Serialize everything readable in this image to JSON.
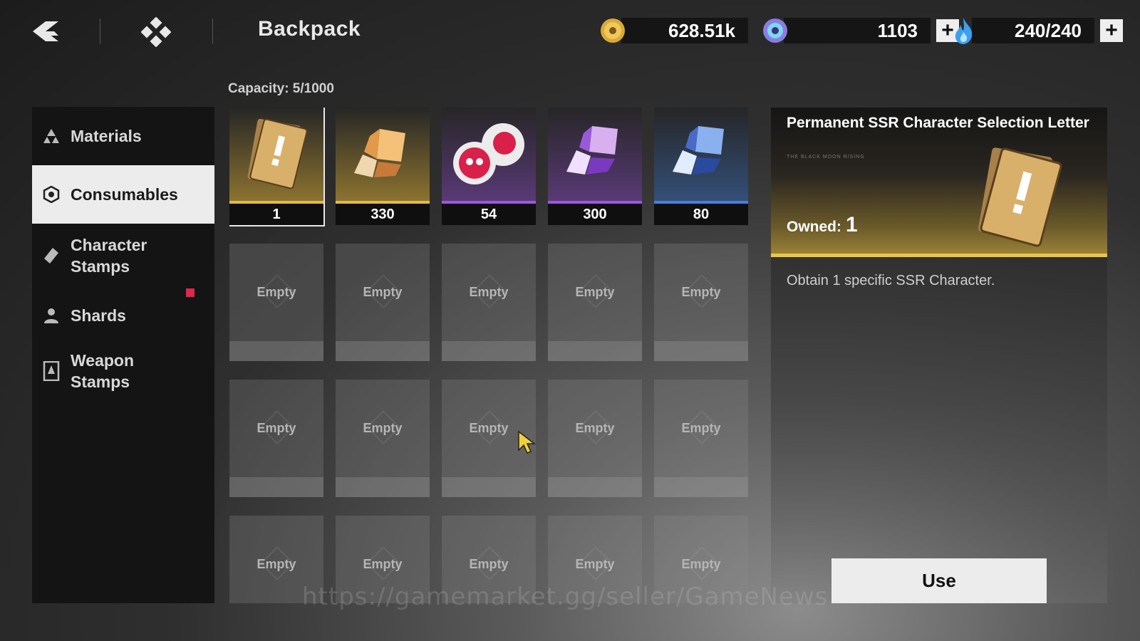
{
  "header": {
    "title": "Backpack",
    "currencies": [
      {
        "name": "gold-coin",
        "value": "628.51k",
        "has_plus": false
      },
      {
        "name": "gem",
        "value": "1103",
        "has_plus": true
      },
      {
        "name": "stamina",
        "value": "240/240",
        "has_plus": true
      }
    ],
    "plus_label": "+"
  },
  "sidebar": {
    "items": [
      {
        "label": "Materials",
        "icon": "materials-icon",
        "active": false
      },
      {
        "label": "Consumables",
        "icon": "consumables-icon",
        "active": true
      },
      {
        "label": "Character Stamps",
        "icon": "character-stamps-icon",
        "active": false
      },
      {
        "label": "Shards",
        "icon": "shards-icon",
        "active": false,
        "badge": true
      },
      {
        "label": "Weapon Stamps",
        "icon": "weapon-stamps-icon",
        "active": false
      }
    ]
  },
  "capacity": "Capacity: 5/1000",
  "items": [
    {
      "name": "ssr-selection-letter",
      "count": "1",
      "rarity": "#e0b94a",
      "selected": true
    },
    {
      "name": "gold-crystal",
      "count": "330",
      "rarity": "#e0b94a"
    },
    {
      "name": "skull-orbs",
      "count": "54",
      "rarity": "#9b59d8"
    },
    {
      "name": "purple-crystal",
      "count": "300",
      "rarity": "#9b59d8"
    },
    {
      "name": "blue-crystal",
      "count": "80",
      "rarity": "#4a7fd8"
    }
  ],
  "empty_label": "Empty",
  "detail": {
    "name": "Permanent SSR Character Selection Letter",
    "owned_label": "Owned:",
    "owned_count": "1",
    "description": "Obtain 1 specific SSR Character.",
    "flavor": "THE BLACK MOON RISING"
  },
  "use_button": "Use",
  "watermark": "https://gamemarket.gg/seller/GameNews"
}
